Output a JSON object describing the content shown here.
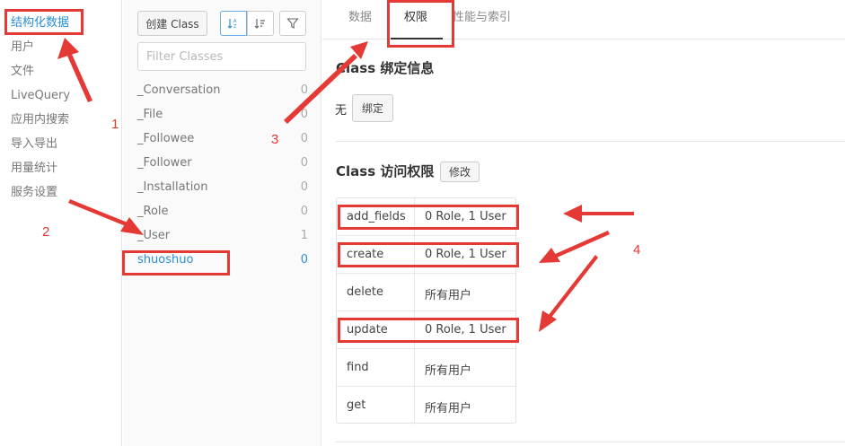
{
  "nav": {
    "items": [
      {
        "label": "结构化数据",
        "active": true
      },
      {
        "label": "用户"
      },
      {
        "label": "文件"
      },
      {
        "label": "LiveQuery"
      },
      {
        "label": "应用内搜索"
      },
      {
        "label": "导入导出"
      },
      {
        "label": "用量统计"
      },
      {
        "label": "服务设置"
      }
    ]
  },
  "classes": {
    "create_label": "创建 Class",
    "sort_alpha_icon": "sort-alpha-icon",
    "sort_count_icon": "sort-count-icon",
    "filter_icon": "filter-icon",
    "filter_placeholder": "Filter Classes",
    "items": [
      {
        "name": "_Conversation",
        "count": "0"
      },
      {
        "name": "_File",
        "count": "0"
      },
      {
        "name": "_Followee",
        "count": "0"
      },
      {
        "name": "_Follower",
        "count": "0"
      },
      {
        "name": "_Installation",
        "count": "0"
      },
      {
        "name": "_Role",
        "count": "0"
      },
      {
        "name": "_User",
        "count": "1"
      },
      {
        "name": "shuoshuo",
        "count": "0",
        "selected": true
      }
    ]
  },
  "tabs": [
    {
      "label": "数据"
    },
    {
      "label": "权限",
      "active": true
    },
    {
      "label": "性能与索引"
    }
  ],
  "binding": {
    "title": "Class 绑定信息",
    "value": "无",
    "bind_label": "绑定"
  },
  "access": {
    "title": "Class 访问权限",
    "edit_label": "修改",
    "rows": [
      {
        "name": "add_fields",
        "value": "0 Role, 1 User"
      },
      {
        "name": "create",
        "value": "0 Role, 1 User"
      },
      {
        "name": "delete",
        "value": "所有用户"
      },
      {
        "name": "update",
        "value": "0 Role, 1 User"
      },
      {
        "name": "find",
        "value": "所有用户"
      },
      {
        "name": "get",
        "value": "所有用户"
      }
    ]
  },
  "annotations": {
    "numbers": [
      "1",
      "2",
      "3",
      "4"
    ],
    "color": "#e53935"
  },
  "colors": {
    "accent": "#2a8fd7",
    "annotation": "#e53935"
  }
}
